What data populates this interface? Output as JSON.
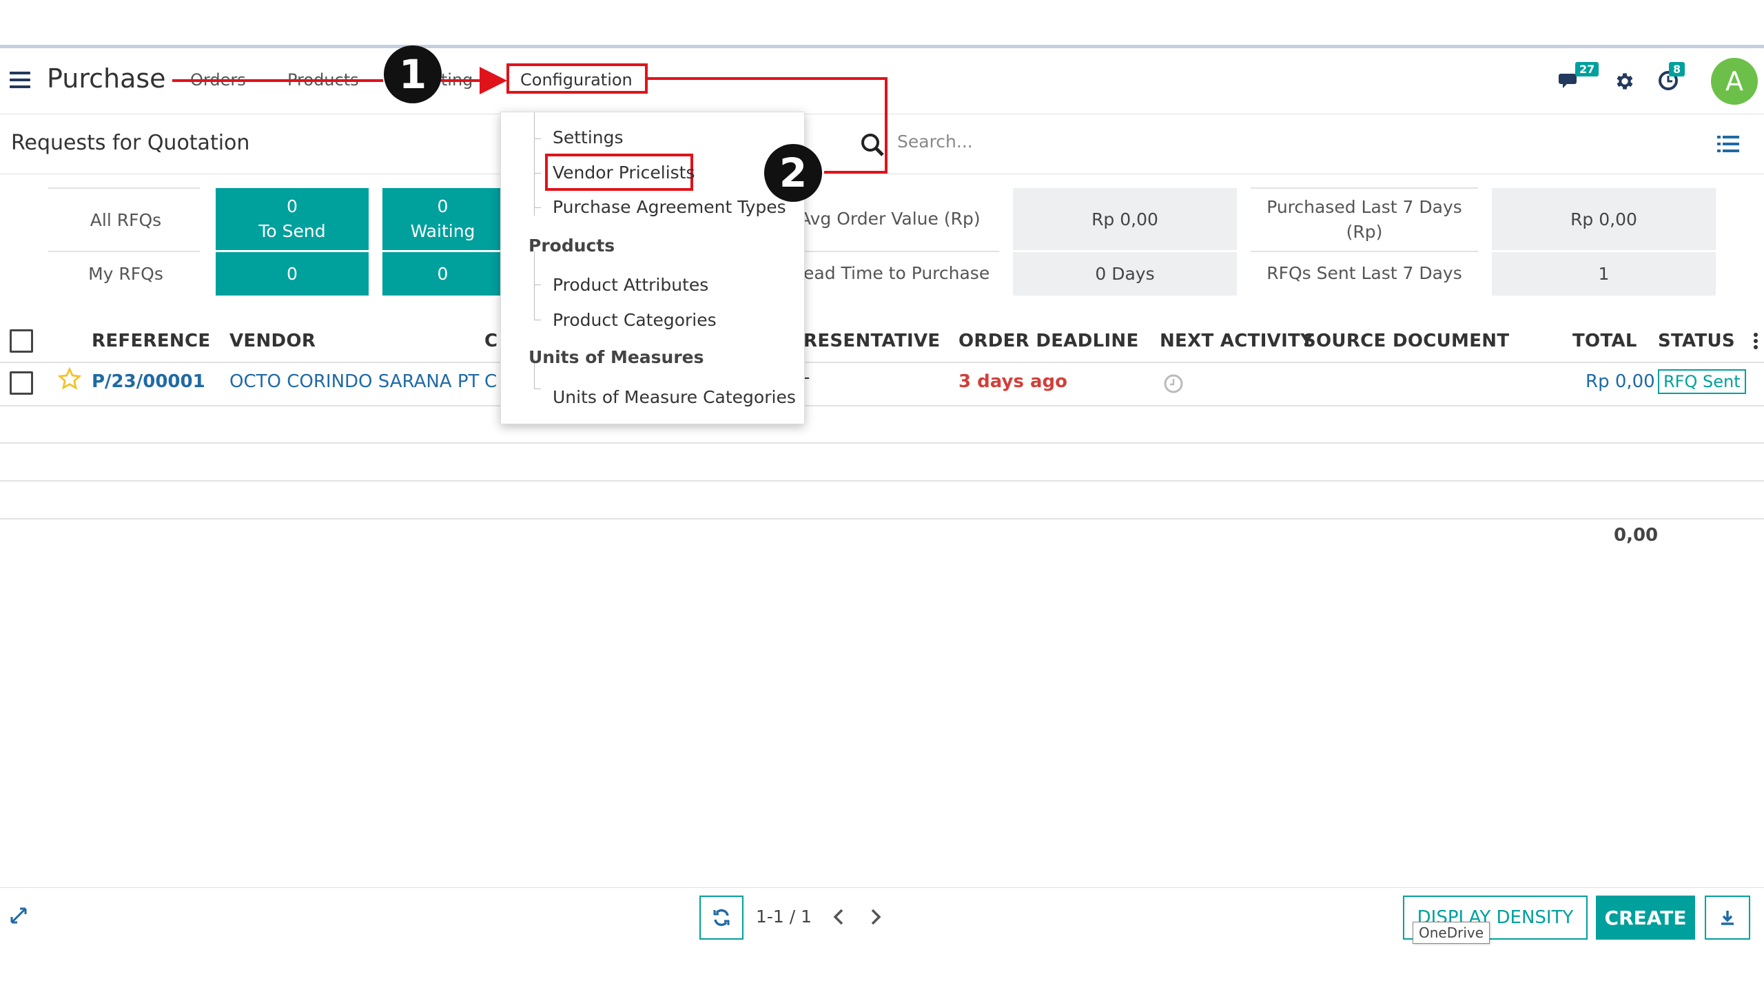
{
  "navbar": {
    "app_title": "Purchase",
    "menu": [
      "Orders",
      "Products",
      "Reporting",
      "Configuration"
    ],
    "reporting_visible": "rting",
    "messages_badge": "27",
    "activities_badge": "8",
    "avatar_letter": "A"
  },
  "control_panel": {
    "breadcrumb": "Requests for Quotation",
    "search_placeholder": "Search..."
  },
  "dashboard": {
    "all_rfqs_label": "All RFQs",
    "my_rfqs_label": "My RFQs",
    "to_send": {
      "count": "0",
      "label": "To Send",
      "my_count": "0"
    },
    "waiting": {
      "count": "0",
      "label": "Waiting",
      "my_count": "0"
    },
    "avg_order_label": "Avg Order Value (Rp)",
    "avg_order_value": "Rp 0,00",
    "lead_time_label": "ead Time to Purchase",
    "lead_time_value": "0  Days",
    "purchased_label_1": "Purchased Last 7 Days",
    "purchased_label_2": "(Rp)",
    "purchased_value": "Rp 0,00",
    "rfqs_sent_label": "RFQs Sent Last 7 Days",
    "rfqs_sent_value": "1"
  },
  "table": {
    "headers": {
      "reference": "REFERENCE",
      "vendor": "VENDOR",
      "company_partial": "C",
      "representative_partial": "RESENTATIVE",
      "order_deadline": "ORDER DEADLINE",
      "next_activity": "NEXT ACTIVITY",
      "source_document": "SOURCE DOCUMENT",
      "total": "TOTAL",
      "status": "STATUS"
    },
    "rows": [
      {
        "reference": "P/23/00001",
        "vendor": "OCTO CORINDO SARANA PT",
        "company_partial": "C",
        "representative": "-",
        "order_deadline": "3 days ago",
        "total": "Rp 0,00",
        "status": "RFQ Sent"
      }
    ],
    "sum_total": "0,00"
  },
  "dropdown": {
    "settings": "Settings",
    "vendor_pricelists": "Vendor Pricelists",
    "purchase_agreement_types": "Purchase Agreement Types",
    "products_header": "Products",
    "product_attributes": "Product Attributes",
    "product_categories": "Product Categories",
    "uom_header": "Units of Measures",
    "uom_categories": "Units of Measure Categories"
  },
  "annotations": {
    "step1": "1",
    "step2": "2"
  },
  "footer": {
    "pager": "1-1 / 1",
    "display_density": "DISPLAY DENSITY",
    "create": "CREATE",
    "tooltip": "OneDrive"
  },
  "colors": {
    "accent": "#00a09d",
    "annotation_red": "#e0131a",
    "link": "#1f6aa5",
    "deadline": "#d23f3a"
  }
}
